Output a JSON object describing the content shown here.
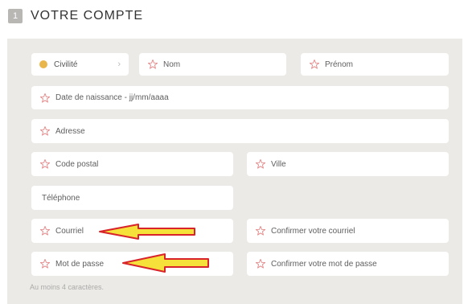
{
  "section": {
    "step_number": "1",
    "title": "VOTRE COMPTE"
  },
  "fields": {
    "civilite": {
      "placeholder": "Civilité",
      "required": false
    },
    "nom": {
      "placeholder": "Nom",
      "required": true
    },
    "prenom": {
      "placeholder": "Prénom",
      "required": true
    },
    "date_naissance": {
      "placeholder": "Date de naissance - jj/mm/aaaa",
      "required": true
    },
    "adresse": {
      "placeholder": "Adresse",
      "required": true
    },
    "code_postal": {
      "placeholder": "Code postal",
      "required": true
    },
    "ville": {
      "placeholder": "Ville",
      "required": true
    },
    "telephone": {
      "placeholder": "Téléphone",
      "required": false
    },
    "courriel": {
      "placeholder": "Courriel",
      "required": true
    },
    "confirmer_courriel": {
      "placeholder": "Confirmer votre courriel",
      "required": true
    },
    "mot_de_passe": {
      "placeholder": "Mot de passe",
      "required": true
    },
    "confirmer_mot_de_passe": {
      "placeholder": "Confirmer votre mot de passe",
      "required": true
    }
  },
  "hint": "Au moins 4 caractères.",
  "colors": {
    "panel_bg": "#eceae6",
    "star_stroke": "#e58a8a",
    "civilite_dot": "#e9b64b",
    "arrow_fill": "#f5e13a",
    "arrow_stroke": "#d8232a"
  }
}
